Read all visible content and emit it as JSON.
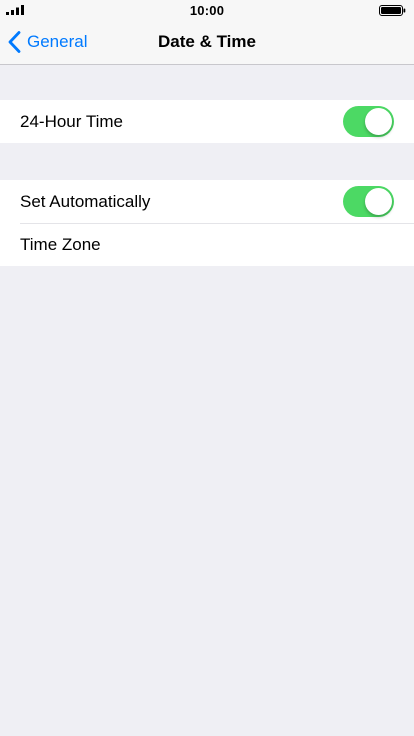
{
  "status_bar": {
    "time": "10:00"
  },
  "nav": {
    "back_label": "General",
    "title": "Date & Time"
  },
  "settings": {
    "group1": [
      {
        "label": "24-Hour Time",
        "toggle_on": true
      }
    ],
    "group2": [
      {
        "label": "Set Automatically",
        "toggle_on": true
      },
      {
        "label": "Time Zone"
      }
    ]
  },
  "colors": {
    "accent": "#007aff",
    "toggle_on": "#4cd964",
    "background": "#efeff4"
  }
}
